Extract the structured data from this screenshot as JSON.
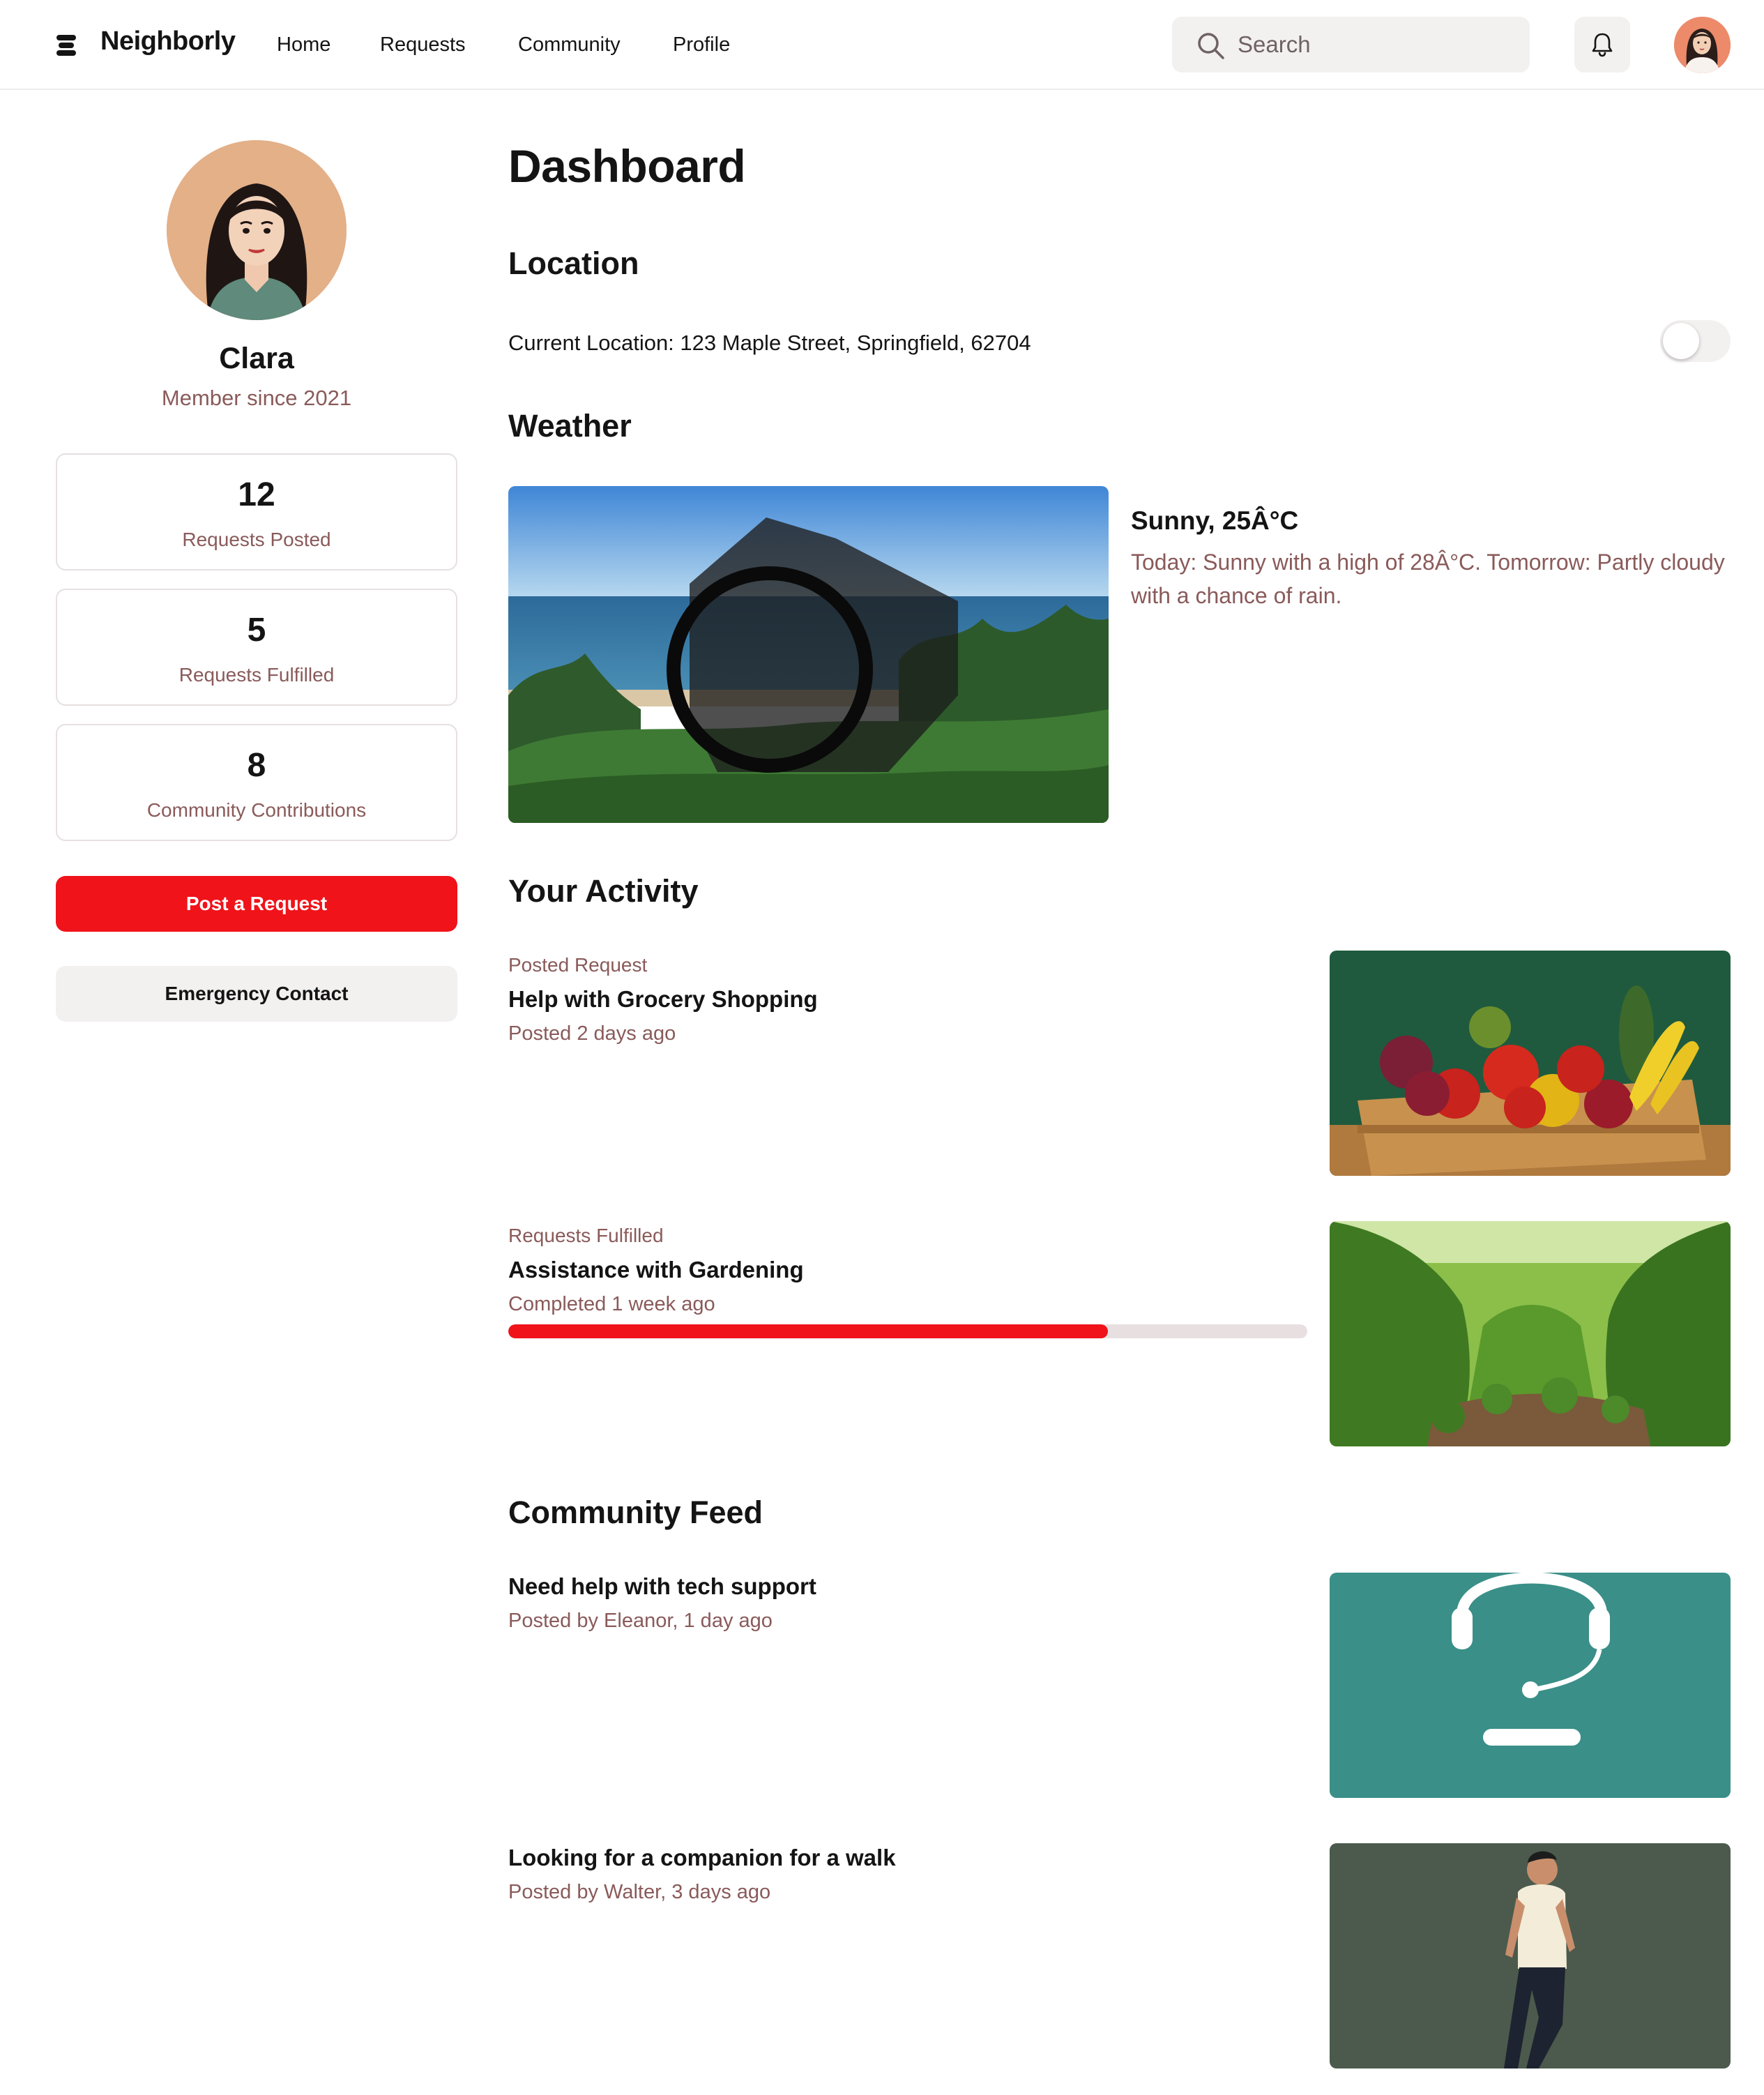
{
  "app": {
    "name": "Neighborly",
    "nav": [
      "Home",
      "Requests",
      "Community",
      "Profile"
    ],
    "search_placeholder": "Search"
  },
  "profile": {
    "name": "Clara",
    "member_since": "Member since 2021",
    "stats": [
      {
        "value": "12",
        "label": "Requests Posted"
      },
      {
        "value": "5",
        "label": "Requests Fulfilled"
      },
      {
        "value": "8",
        "label": "Community Contributions"
      }
    ],
    "post_button": "Post a Request",
    "emergency_button": "Emergency Contact"
  },
  "dashboard": {
    "title": "Dashboard",
    "location": {
      "heading": "Location",
      "text": "Current Location: 123 Maple Street, Springfield, 62704",
      "toggle_on": false
    },
    "weather": {
      "heading": "Weather",
      "title": "Sunny, 25Â°C",
      "description": "Today: Sunny with a high of 28Â°C. Tomorrow: Partly cloudy with a chance of rain."
    },
    "activity": {
      "heading": "Your Activity",
      "items": [
        {
          "category": "Posted Request",
          "title": "Help with Grocery Shopping",
          "meta": "Posted 2 days ago",
          "image": "vegetables-crate"
        },
        {
          "category": "Requests Fulfilled",
          "title": "Assistance with Gardening",
          "meta": "Completed 1 week ago",
          "progress": 0.75,
          "image": "garden-shrubs"
        }
      ]
    },
    "feed": {
      "heading": "Community Feed",
      "items": [
        {
          "title": "Need help with tech support",
          "meta": "Posted by Eleanor, 1 day ago",
          "image": "headset-support"
        },
        {
          "title": "Looking for a companion for a walk",
          "meta": "Posted by Walter, 3 days ago",
          "image": "walking-man"
        }
      ]
    }
  },
  "colors": {
    "accent": "#f0131a",
    "muted_text": "#8a5a5a",
    "surface": "#f3f0f0"
  }
}
